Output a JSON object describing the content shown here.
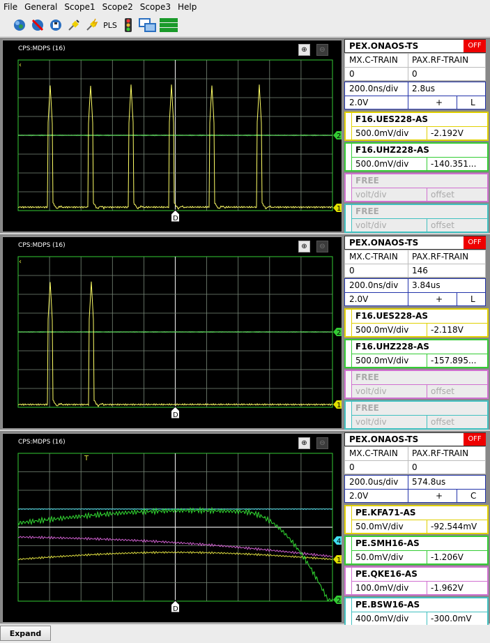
{
  "menu": [
    "File",
    "General",
    "Scope1",
    "Scope2",
    "Scope3",
    "Help"
  ],
  "toolbar": {
    "icons": [
      "globe-icon",
      "no-connection-icon",
      "save-icon",
      "plug-icon",
      "plug-spark-icon",
      "pls-icon",
      "traffic-light-icon",
      "windows-icon",
      "layout-bars-icon"
    ],
    "pls_label": "PLS"
  },
  "scopes": [
    {
      "plot_title": "CPS:MDPS (16)",
      "marker_label": "D",
      "header": {
        "name": "PEX.ONAOS-TS",
        "state": "OFF"
      },
      "train": {
        "left_label": "MX.C-TRAIN",
        "right_label": "PAX.RF-TRAIN",
        "left_value": "0",
        "right_value": "0"
      },
      "timebase": {
        "div": "200.0ns/div",
        "delay": "2.8us",
        "level": "2.0V",
        "slope": "+",
        "coupling": "L"
      },
      "channels": [
        {
          "name": "F16.UES228-AS",
          "scale": "500.0mV/div",
          "offset": "-2.192V",
          "color": "#e0d000",
          "idx": "1",
          "state": "on"
        },
        {
          "name": "F16.UHZ228-AS",
          "scale": "500.0mV/div",
          "offset": "-140.351...",
          "color": "#33cc33",
          "idx": "2",
          "state": "on"
        },
        {
          "name": "FREE",
          "scale": "volt/div",
          "offset": "offset",
          "color": "#d070d0",
          "idx": "3",
          "state": "free"
        },
        {
          "name": "FREE",
          "scale": "volt/div",
          "offset": "offset",
          "color": "#40c0c0",
          "idx": "4",
          "state": "free"
        }
      ],
      "markers": [
        {
          "idx": "2",
          "color": "#33cc33"
        },
        {
          "idx": "1",
          "color": "#e0e000"
        }
      ]
    },
    {
      "plot_title": "CPS:MDPS (16)",
      "marker_label": "D",
      "header": {
        "name": "PEX.ONAOS-TS",
        "state": "OFF"
      },
      "train": {
        "left_label": "MX.C-TRAIN",
        "right_label": "PAX.RF-TRAIN",
        "left_value": "0",
        "right_value": "146"
      },
      "timebase": {
        "div": "200.0ns/div",
        "delay": "3.84us",
        "level": "2.0V",
        "slope": "+",
        "coupling": "L"
      },
      "channels": [
        {
          "name": "F16.UES228-AS",
          "scale": "500.0mV/div",
          "offset": "-2.118V",
          "color": "#e0d000",
          "idx": "1",
          "state": "on"
        },
        {
          "name": "F16.UHZ228-AS",
          "scale": "500.0mV/div",
          "offset": "-157.895...",
          "color": "#33cc33",
          "idx": "2",
          "state": "on"
        },
        {
          "name": "FREE",
          "scale": "volt/div",
          "offset": "offset",
          "color": "#d070d0",
          "idx": "3",
          "state": "free"
        },
        {
          "name": "FREE",
          "scale": "volt/div",
          "offset": "offset",
          "color": "#40c0c0",
          "idx": "4",
          "state": "free"
        }
      ],
      "markers": [
        {
          "idx": "2",
          "color": "#33cc33"
        },
        {
          "idx": "1",
          "color": "#e0e000"
        }
      ]
    },
    {
      "plot_title": "CPS:MDPS (16)",
      "marker_label": "D",
      "trigger_label": "T",
      "header": {
        "name": "PEX.ONAOS-TS",
        "state": "OFF"
      },
      "train": {
        "left_label": "MX.C-TRAIN",
        "right_label": "PAX.RF-TRAIN",
        "left_value": "0",
        "right_value": "0"
      },
      "timebase": {
        "div": "200.0us/div",
        "delay": "574.8us",
        "level": "2.0V",
        "slope": "+",
        "coupling": "C"
      },
      "channels": [
        {
          "name": "PE.KFA71-AS",
          "scale": "50.0mV/div",
          "offset": "-92.544mV",
          "color": "#e0d000",
          "idx": "1",
          "state": "on"
        },
        {
          "name": "PE.SMH16-AS",
          "scale": "50.0mV/div",
          "offset": "-1.206V",
          "color": "#33cc33",
          "idx": "2",
          "state": "on"
        },
        {
          "name": "PE.QKE16-AS",
          "scale": "100.0mV/div",
          "offset": "-1.962V",
          "color": "#d070d0",
          "idx": "3",
          "state": "on"
        },
        {
          "name": "PE.BSW16-AS",
          "scale": "400.0mV/div",
          "offset": "-300.0mV",
          "color": "#40c0c0",
          "idx": "4",
          "state": "on"
        }
      ],
      "markers": [
        {
          "idx": "4",
          "color": "#40e0f0"
        },
        {
          "idx": "1",
          "color": "#e0e000"
        },
        {
          "idx": "2",
          "color": "#33cc33"
        }
      ]
    }
  ],
  "status": {
    "expand_label": "Expand"
  }
}
